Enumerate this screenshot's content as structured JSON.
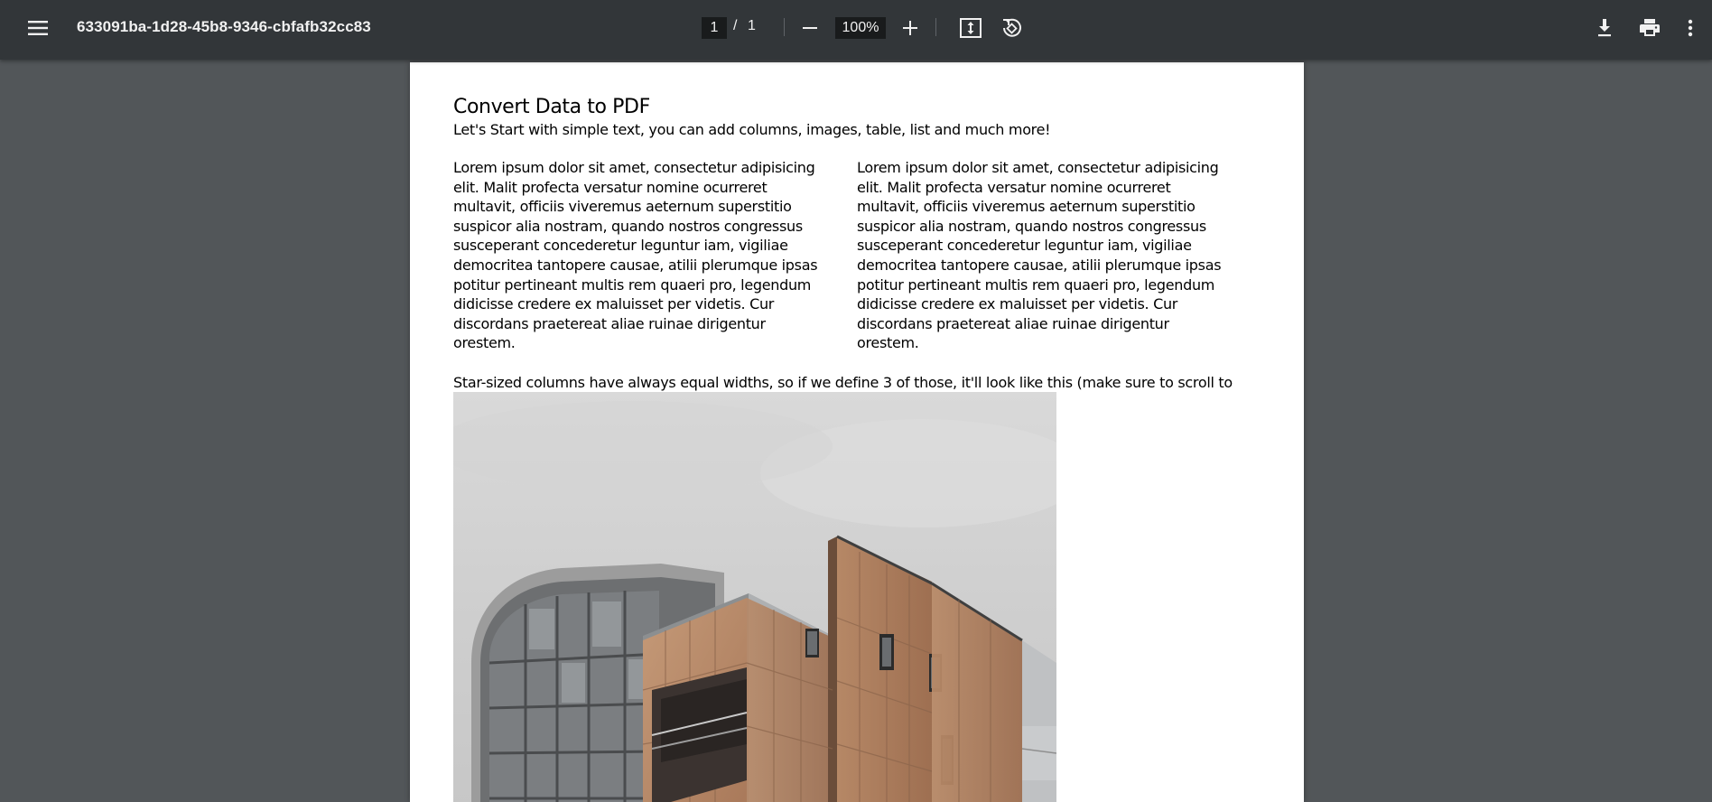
{
  "toolbar": {
    "menu_icon": "hamburger-menu-icon",
    "title": "633091ba-1d28-45b8-9346-cbfafb32cc83",
    "current_page": "1",
    "page_separator": "/",
    "total_pages": "1",
    "zoom_out_icon": "minus-icon",
    "zoom_level": "100%",
    "zoom_in_icon": "plus-icon",
    "fit_page_icon": "fit-to-page-icon",
    "rotate_icon": "rotate-counterclockwise-icon",
    "download_icon": "download-icon",
    "print_icon": "print-icon",
    "more_icon": "more-vertical-icon"
  },
  "document": {
    "heading": "Convert Data to PDF",
    "subheading": "Let's Start with simple text, you can add columns, images, table, list and much more!",
    "columns": [
      "Lorem ipsum dolor sit amet, consectetur adipisicing elit. Malit profecta versatur nomine ocurreret multavit, officiis viveremus aeternum superstitio suspicor alia nostram, quando nostros congressus susceperant concederetur leguntur iam, vigiliae democritea tantopere causae, atilii plerumque ipsas potitur pertineant multis rem quaeri pro, legendum didicisse credere ex maluisset per videtis. Cur discordans praetereat aliae ruinae dirigentur orestem.",
      "Lorem ipsum dolor sit amet, consectetur adipisicing elit. Malit profecta versatur nomine ocurreret multavit, officiis viveremus aeternum superstitio suspicor alia nostram, quando nostros congressus susceperant concederetur leguntur iam, vigiliae democritea tantopere causae, atilii plerumque ipsas potitur pertineant multis rem quaeri pro, legendum didicisse credere ex maluisset per videtis. Cur discordans praetereat aliae ruinae dirigentur orestem."
    ],
    "paragraph": "Star-sized columns have always equal widths, so if we define 3 of those, it'll look like this (make sure to scroll to the next page, as we have a couple of more examples):",
    "image_icon": "building-photo",
    "colors": {
      "toolbar_bg": "#323639",
      "viewer_bg": "#525659",
      "page_bg": "#ffffff"
    }
  }
}
